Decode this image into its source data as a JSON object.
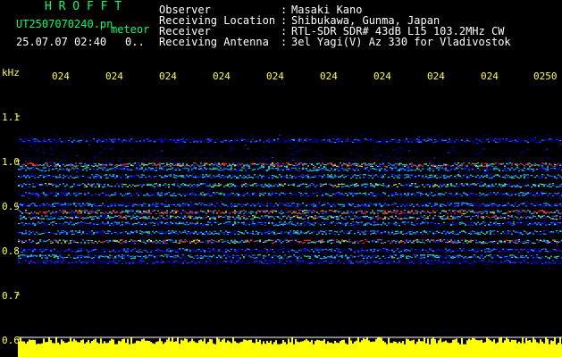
{
  "header": {
    "brand": "H R O F F T",
    "filename": "UT2507070240.pn",
    "meteor_label": "meteor",
    "timestamp": "25.07.07 02:40",
    "count": "0..",
    "fields": [
      {
        "label": "Observer",
        "sep": ":",
        "value": "Masaki Kano"
      },
      {
        "label": "Receiving Location",
        "sep": ":",
        "value": "Shibukawa, Gunma, Japan"
      },
      {
        "label": "Receiver",
        "sep": ":",
        "value": "RTL-SDR SDR# 43dB L15 103.2MHz CW"
      },
      {
        "label": "Receiving Antenna",
        "sep": ":",
        "value": "3el Yagi(V) Az 330 for Vladivostok"
      }
    ]
  },
  "axis": {
    "y_unit": "kHz",
    "y_ticks": [
      "1.1",
      "1.0",
      "0.9",
      "0.8",
      "0.7",
      "0.6"
    ],
    "x_ticks": [
      "024",
      "024",
      "024",
      "024",
      "024",
      "024",
      "024",
      "024",
      "024",
      "0250"
    ]
  },
  "colors": {
    "background": "#000000",
    "axis_text": "#ffff33",
    "header_green": "#00ff66",
    "header_text": "#ffffff",
    "signal_floor": "#ffff00"
  }
}
